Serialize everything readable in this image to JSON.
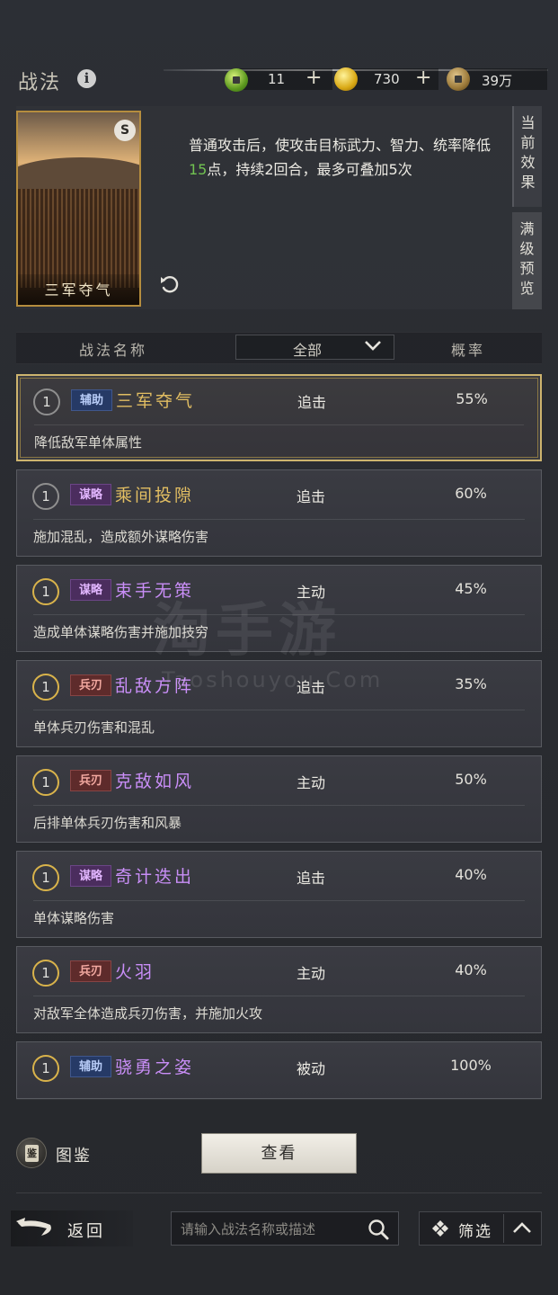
{
  "header": {
    "title": "战法",
    "resources": [
      {
        "icon": "jade-coin-icon",
        "value": "11"
      },
      {
        "icon": "gold-ingot-icon",
        "value": "730"
      },
      {
        "icon": "copper-coin-icon",
        "value": "39万"
      }
    ]
  },
  "preview": {
    "card_name": "三军夺气",
    "card_badge": "S",
    "desc_part1": "普通攻击后，使攻击目标武力、智力、统率降低",
    "desc_highlight": "15",
    "desc_part2": "点，持续2回合，最多可叠加5次",
    "tabs": [
      "当前效果",
      "满级预览"
    ]
  },
  "columns": {
    "name": "战法名称",
    "filter": "全部",
    "prob": "概率"
  },
  "tactics": [
    {
      "level": "1",
      "tag": "辅助",
      "tag_type": "fz",
      "name": "三军夺气",
      "name_color": "gold",
      "type": "追击",
      "prob": "55%",
      "desc": "降低敌军单体属性",
      "selected": true
    },
    {
      "level": "1",
      "tag": "谋略",
      "tag_type": "ml",
      "name": "乘间投隙",
      "name_color": "gold",
      "type": "追击",
      "prob": "60%",
      "desc": "施加混乱，造成额外谋略伤害",
      "selected": false
    },
    {
      "level": "1",
      "tag": "谋略",
      "tag_type": "ml",
      "name": "束手无策",
      "name_color": "purple",
      "type": "主动",
      "prob": "45%",
      "desc": "造成单体谋略伤害并施加技穷",
      "selected": false
    },
    {
      "level": "1",
      "tag": "兵刃",
      "tag_type": "br",
      "name": "乱敌方阵",
      "name_color": "purple",
      "type": "追击",
      "prob": "35%",
      "desc": "单体兵刃伤害和混乱",
      "selected": false
    },
    {
      "level": "1",
      "tag": "兵刃",
      "tag_type": "br",
      "name": "克敌如风",
      "name_color": "purple",
      "type": "主动",
      "prob": "50%",
      "desc": "后排单体兵刃伤害和风暴",
      "selected": false
    },
    {
      "level": "1",
      "tag": "谋略",
      "tag_type": "ml",
      "name": "奇计迭出",
      "name_color": "purple",
      "type": "追击",
      "prob": "40%",
      "desc": "单体谋略伤害",
      "selected": false
    },
    {
      "level": "1",
      "tag": "兵刃",
      "tag_type": "br",
      "name": "火羽",
      "name_color": "purple",
      "type": "主动",
      "prob": "40%",
      "desc": "对敌军全体造成兵刃伤害，并施加火攻",
      "selected": false
    },
    {
      "level": "1",
      "tag": "辅助",
      "tag_type": "fz",
      "name": "骁勇之姿",
      "name_color": "purple",
      "type": "被动",
      "prob": "100%",
      "desc": "",
      "selected": false
    }
  ],
  "watermark": {
    "main": "淘手游",
    "sub": "Taoshouyou.Com"
  },
  "bottom": {
    "tujian_label": "图鉴",
    "tujian_icon_text": "鉴",
    "view_button": "查看",
    "back_label": "返回",
    "search_placeholder": "请输入战法名称或描述",
    "filter_label": "筛选"
  }
}
